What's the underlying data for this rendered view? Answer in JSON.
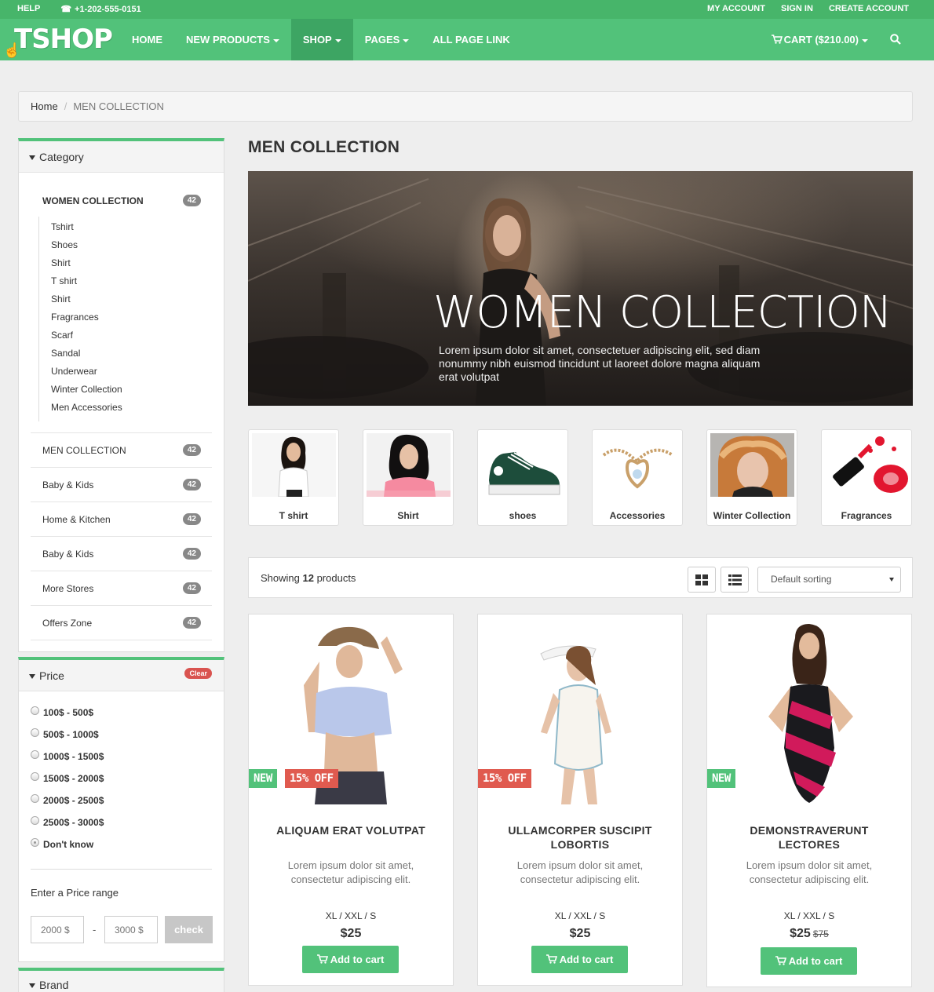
{
  "topbar": {
    "help": "HELP",
    "phone": "+1-202-555-0151",
    "my_account": "MY ACCOUNT",
    "sign_in": "SIGN IN",
    "create_account": "CREATE ACCOUNT"
  },
  "nav": {
    "logo": "TSHOP",
    "items": [
      "HOME",
      "NEW PRODUCTS",
      "SHOP",
      "PAGES",
      "ALL PAGE LINK"
    ],
    "active": "SHOP",
    "cart": "CART ($210.00)"
  },
  "breadcrumb": {
    "home": "Home",
    "current": "MEN COLLECTION"
  },
  "sidebar": {
    "category_title": "Category",
    "categories": [
      {
        "label": "WOMEN COLLECTION",
        "count": "42"
      },
      {
        "label": "MEN COLLECTION",
        "count": "42"
      },
      {
        "label": "Baby & Kids",
        "count": "42"
      },
      {
        "label": "Home & Kitchen",
        "count": "42"
      },
      {
        "label": "Baby & Kids",
        "count": "42"
      },
      {
        "label": "More Stores",
        "count": "42"
      },
      {
        "label": "Offers Zone",
        "count": "42"
      }
    ],
    "subcategories": [
      "Tshirt",
      "Shoes",
      "Shirt",
      "T shirt",
      "Shirt",
      "Fragrances",
      "Scarf",
      "Sandal",
      "Underwear",
      "Winter Collection",
      "Men Accessories"
    ],
    "price_title": "Price",
    "clear": "Clear",
    "price_options": [
      "100$ - 500$",
      "500$ - 1000$",
      "1000$ - 1500$",
      "1500$ - 2000$",
      "2000$ - 2500$",
      "2500$ - 3000$",
      "Don't know"
    ],
    "selected_price": "Don't know",
    "range_label": "Enter a Price range",
    "range_min_placeholder": "2000 $",
    "range_max_placeholder": "3000 $",
    "range_button": "check",
    "brand_title": "Brand"
  },
  "main": {
    "title": "MEN COLLECTION",
    "banner_title": "WOMEN COLLECTION",
    "banner_text": "Lorem ipsum dolor sit amet, consectetuer adipiscing elit, sed diam nonummy nibh euismod tincidunt ut laoreet dolore magna aliquam erat volutpat",
    "tiles": [
      "T shirt",
      "Shirt",
      "shoes",
      "Accessories",
      "Winter Collection",
      "Fragrances"
    ],
    "showing_prefix": "Showing ",
    "showing_count": "12",
    "showing_suffix": " products",
    "sort_value": "Default sorting"
  },
  "products": [
    {
      "name": "ALIQUAM ERAT VOLUTPAT",
      "desc": "Lorem ipsum dolor sit amet, consectetur adipiscing elit.",
      "sizes": "XL / XXL / S",
      "price": "$25",
      "old_price": "",
      "tags": [
        "NEW",
        "15% OFF"
      ]
    },
    {
      "name": "ULLAMCORPER SUSCIPIT LOBORTIS",
      "desc": "Lorem ipsum dolor sit amet, consectetur adipiscing elit.",
      "sizes": "XL / XXL / S",
      "price": "$25",
      "old_price": "",
      "tags": [
        "15% OFF"
      ]
    },
    {
      "name": "DEMONSTRAVERUNT LECTORES",
      "desc": "Lorem ipsum dolor sit amet, consectetur adipiscing elit.",
      "sizes": "XL / XXL / S",
      "price": "$25",
      "old_price": "$75",
      "tags": [
        "NEW"
      ]
    }
  ],
  "add_to_cart": "Add to cart",
  "colors": {
    "brand_green": "#52c27a",
    "top_green": "#47b56a",
    "active_green": "#3da563",
    "sale_red": "#e05a4f"
  }
}
